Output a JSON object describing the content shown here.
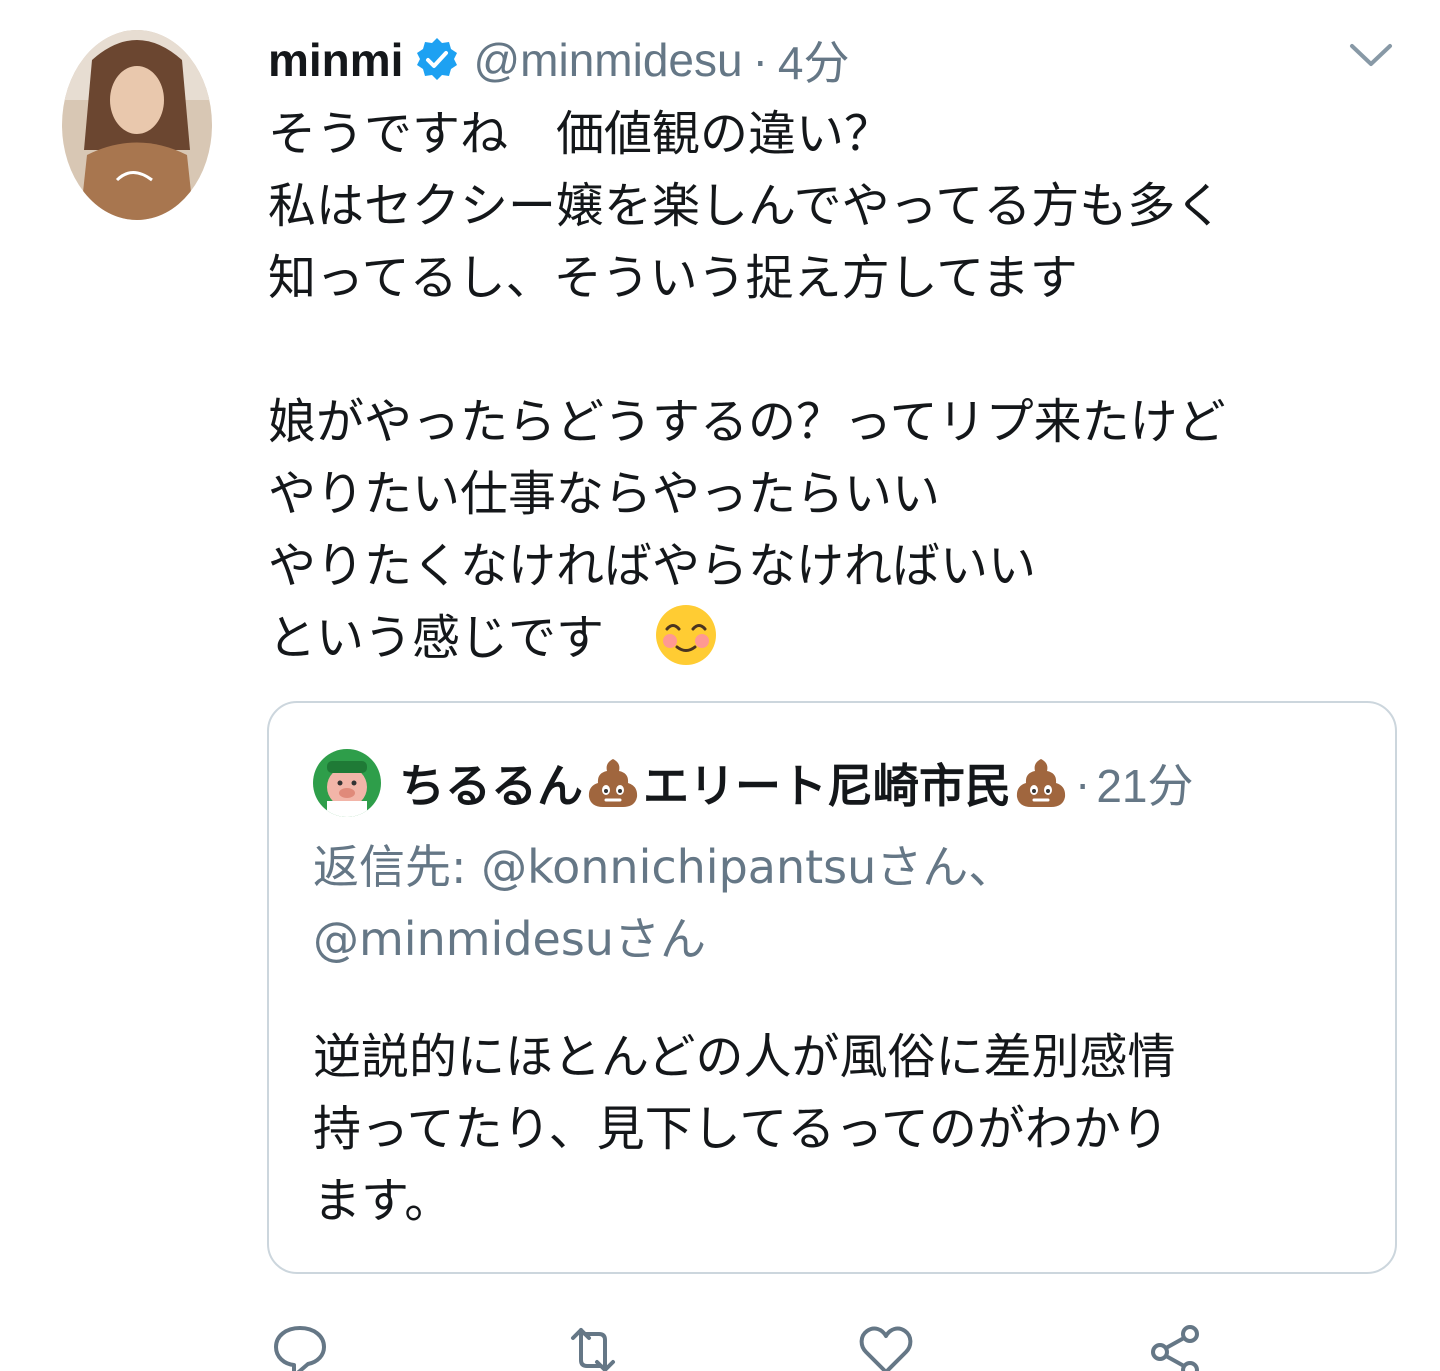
{
  "tweet": {
    "display_name": "minmi",
    "handle": "@minmidesu",
    "separator": "·",
    "time": "4分",
    "lines": [
      "そうですね　価値観の違い？",
      "私はセクシー嬢を楽しんでやってる方も多く",
      "知ってるし、そういう捉え方してます",
      "",
      "娘がやったらどうするの？ってリプ来たけど",
      "やりたい仕事ならやったらいい",
      "やりたくなければやらなければいい",
      "という感じです"
    ],
    "emoji": "smiling-face-with-smiling-eyes"
  },
  "quote": {
    "name_part1": "ちるるん",
    "name_part2": "エリート尼崎市民",
    "name_emoji": "pile-of-poo",
    "separator": "·",
    "time": "21分",
    "reply_line1": "返信先: @konnichipantsuさん、",
    "reply_line2": "@minmidesuさん",
    "body_lines": [
      "逆説的にほとんどの人が風俗に差別感情",
      "持ってたり、見下してるってのがわかり",
      "ます。"
    ]
  },
  "actions": {
    "reply_icon": "reply-icon",
    "retweet_icon": "retweet-icon",
    "like_icon": "like-icon",
    "share_icon": "share-icon"
  },
  "colors": {
    "text": "#14171a",
    "secondary": "#657786",
    "border": "#ccd6dd",
    "verified": "#1da1f2"
  }
}
